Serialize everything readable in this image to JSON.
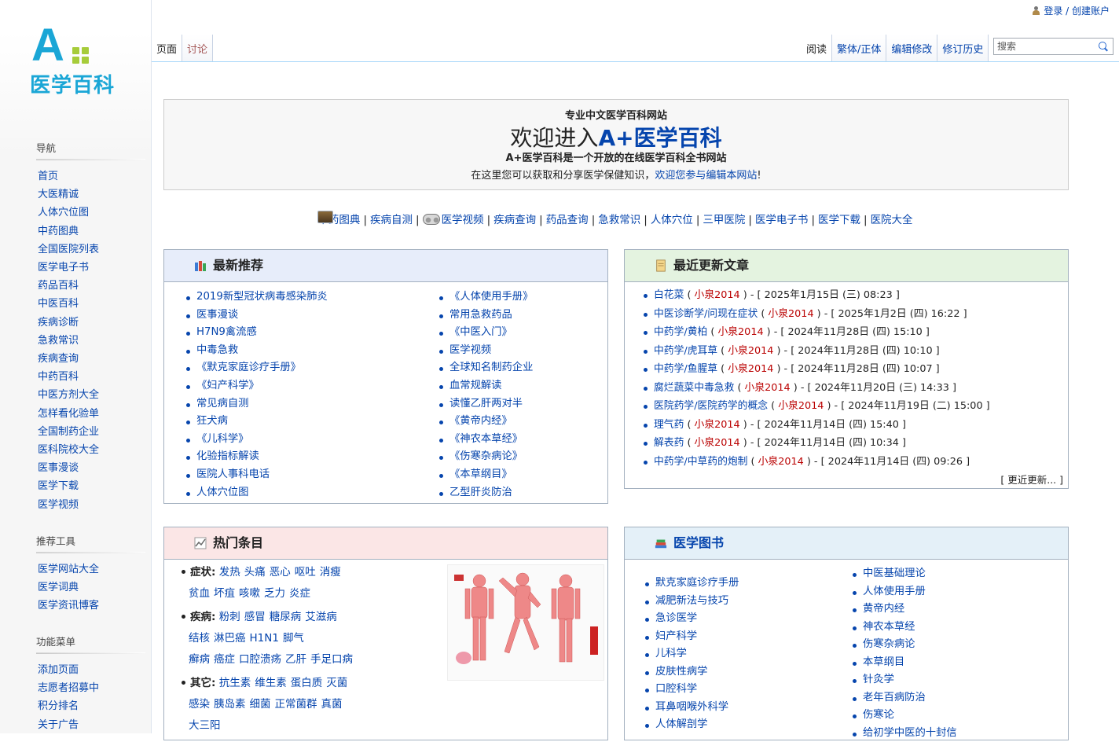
{
  "personal": {
    "login": "登录 / 创建账户"
  },
  "logo": {
    "letter": "A",
    "name": "医学百科"
  },
  "sidebar": [
    {
      "title": "导航",
      "items": [
        "首页",
        "大医精诚",
        "人体穴位图",
        "中药图典",
        "全国医院列表",
        "医学电子书",
        "药品百科",
        "中医百科",
        "疾病诊断",
        "急救常识",
        "疾病查询",
        "中药百科",
        "中医方剂大全",
        "怎样看化验单",
        "全国制药企业",
        "医科院校大全",
        "医事漫谈",
        "医学下载",
        "医学视频"
      ]
    },
    {
      "title": "推荐工具",
      "items": [
        "医学网站大全",
        "医学词典",
        "医学资讯博客"
      ]
    },
    {
      "title": "功能菜单",
      "items": [
        "添加页面",
        "志愿者招募中",
        "积分排名",
        "关于广告"
      ]
    }
  ],
  "tabs": {
    "page": "页面",
    "talk": "讨论",
    "read": "阅读",
    "variant": "繁体/正体",
    "edit": "编辑修改",
    "history": "修订历史"
  },
  "search": {
    "placeholder": "搜索"
  },
  "welcome": {
    "tagline": "专业中文医学百科网站",
    "title_prefix": "欢迎进入",
    "title_brand": "A+医学百科",
    "line1_a": "A+医学百科是一个开放的",
    "line1_b": "在线医学百科全书网站",
    "line2_a": "在这里您可以获取和分享医学保健知识，",
    "line2_b": "欢迎您参与编辑本网站",
    "line2_c": "!"
  },
  "quicklinks": [
    "中药图典",
    "疾病自测",
    "医学视频",
    "疾病查询",
    "药品查询",
    "急救常识",
    "人体穴位",
    "三甲医院",
    "医学电子书",
    "医学下载",
    "医院大全"
  ],
  "recommend": {
    "title": "最新推荐",
    "col1": [
      "2019新型冠状病毒感染肺炎",
      "医事漫谈",
      "H7N9禽流感",
      "中毒急救",
      "《默克家庭诊疗手册》",
      "《妇产科学》",
      "常见病自测",
      "狂犬病",
      "《儿科学》",
      "化验指标解读",
      "医院人事科电话",
      "人体穴位图"
    ],
    "col2": [
      "《人体使用手册》",
      "常用急救药品",
      "《中医入门》",
      "医学视频",
      "全球知名制药企业",
      "血常规解读",
      "读懂乙肝两对半",
      "《黄帝内经》",
      "《神农本草经》",
      "《伤寒杂病论》",
      "《本草纲目》",
      "乙型肝炎防治"
    ]
  },
  "recent": {
    "title": "最近更新文章",
    "items": [
      {
        "t": "白花菜",
        "a": "小泉2014",
        "d": "2025年1月15日 (三) 08:23"
      },
      {
        "t": "中医诊断学/问现在症状",
        "a": "小泉2014",
        "d": "2025年1月2日 (四) 16:22"
      },
      {
        "t": "中药学/黄柏",
        "a": "小泉2014",
        "d": "2024年11月28日 (四) 15:10"
      },
      {
        "t": "中药学/虎耳草",
        "a": "小泉2014",
        "d": "2024年11月28日 (四) 10:10"
      },
      {
        "t": "中药学/鱼腥草",
        "a": "小泉2014",
        "d": "2024年11月28日 (四) 10:07"
      },
      {
        "t": "腐烂蔬菜中毒急救",
        "a": "小泉2014",
        "d": "2024年11月20日 (三) 14:33"
      },
      {
        "t": "医院药学/医院药学的概念",
        "a": "小泉2014",
        "d": "2024年11月19日 (二) 15:00"
      },
      {
        "t": "理气药",
        "a": "小泉2014",
        "d": "2024年11月14日 (四) 15:40"
      },
      {
        "t": "解表药",
        "a": "小泉2014",
        "d": "2024年11月14日 (四) 10:34"
      },
      {
        "t": "中药学/中草药的炮制",
        "a": "小泉2014",
        "d": "2024年11月14日 (四) 09:26"
      }
    ],
    "more": "[ 更近更新... ]"
  },
  "hot": {
    "title": "热门条目",
    "groups": [
      {
        "label": "症状:",
        "lines": [
          [
            "发热",
            "头痛",
            "恶心",
            "呕吐",
            "消瘦"
          ],
          [
            "贫血",
            "坏疽",
            "咳嗽",
            "乏力",
            "炎症"
          ]
        ]
      },
      {
        "label": "疾病:",
        "lines": [
          [
            "粉刺",
            "感冒",
            "糖尿病",
            "艾滋病"
          ],
          [
            "结核",
            "淋巴癌",
            "H1N1",
            "脚气"
          ],
          [
            "癣病",
            "癌症",
            "口腔溃疡",
            "乙肝",
            "手足口病"
          ]
        ]
      },
      {
        "label": "其它:",
        "lines": [
          [
            "抗生素",
            "维生素",
            "蛋白质",
            "灭菌"
          ],
          [
            "感染",
            "胰岛素",
            "细菌",
            "正常菌群",
            "真菌"
          ],
          [
            "大三阳"
          ]
        ]
      }
    ]
  },
  "books": {
    "title": "医学图书",
    "col1": [
      "默克家庭诊疗手册",
      "减肥新法与技巧",
      "急诊医学",
      "妇产科学",
      "儿科学",
      "皮肤性病学",
      "口腔科学",
      "耳鼻咽喉外科学",
      "人体解剖学"
    ],
    "col2": [
      "中医基础理论",
      "人体使用手册",
      "黄帝内经",
      "神农本草经",
      "伤寒杂病论",
      "本草纲目",
      "针灸学",
      "老年百病防治",
      "伤寒论",
      "给初学中医的十封信"
    ]
  },
  "colors": {
    "link": "#0645ad",
    "logo": "#1aa6d6",
    "accent_green": "#a6cc3a",
    "author_red": "#ba0000"
  }
}
